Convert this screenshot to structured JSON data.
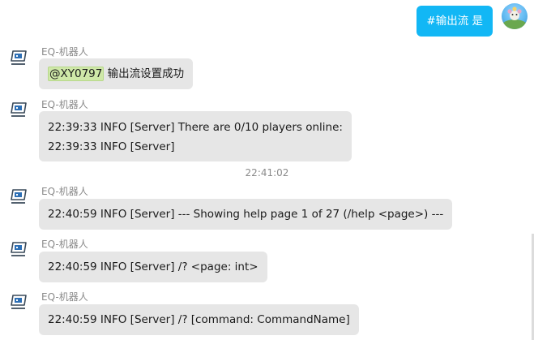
{
  "outgoing": {
    "text": "#输出流 是"
  },
  "bot_name": "EQ-机器人",
  "time_separator": "22:41:02",
  "messages": [
    {
      "sender": "EQ-机器人",
      "mention": "@XY0797",
      "text": " 输出流设置成功"
    },
    {
      "sender": "EQ-机器人",
      "lines": [
        "22:39:33 INFO [Server] There are 0/10 players online:",
        "22:39:33 INFO [Server]"
      ]
    },
    {
      "sender": "EQ-机器人",
      "lines": [
        "22:40:59 INFO [Server] --- Showing help page 1 of 27 (/help <page>) ---"
      ]
    },
    {
      "sender": "EQ-机器人",
      "lines": [
        "22:40:59 INFO [Server] /? <page: int>"
      ]
    },
    {
      "sender": "EQ-机器人",
      "lines": [
        "22:40:59 INFO [Server] /? [command: CommandName]"
      ]
    }
  ],
  "icons": {
    "bot_avatar": "robot-avatar-icon",
    "self_avatar": "user-avatar"
  },
  "colors": {
    "outgoing_bubble": "#12b7f5",
    "incoming_bubble": "#e6e6e6",
    "mention_highlight": "#cfe8a8",
    "meta_text": "#8a8a8a"
  }
}
